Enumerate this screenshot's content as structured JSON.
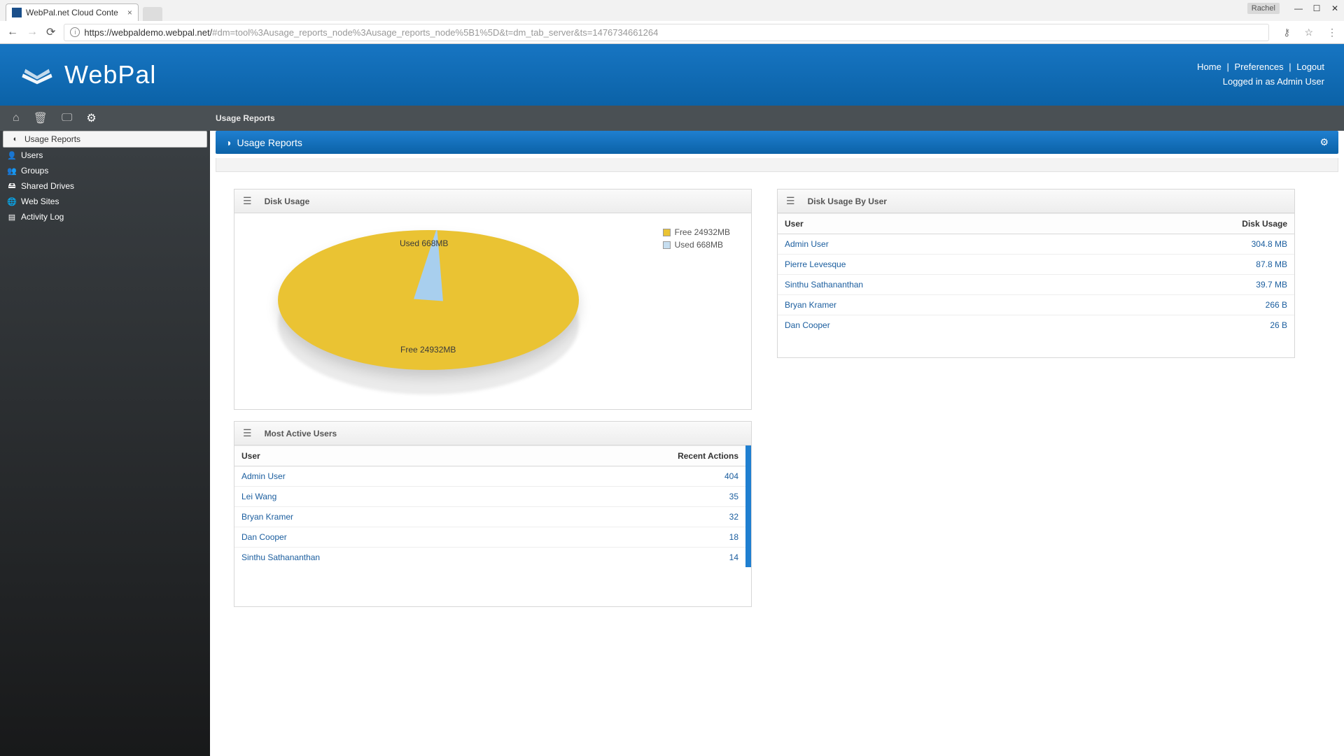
{
  "browser": {
    "tab_title": "WebPal.net Cloud Conte",
    "user_tag": "Rachel",
    "url_host": "https://webpaldemo.webpal.net/",
    "url_rest": "#dm=tool%3Ausage_reports_node%3Ausage_reports_node%5B1%5D&t=dm_tab_server&ts=1476734661264"
  },
  "header": {
    "links": {
      "home": "Home",
      "prefs": "Preferences",
      "logout": "Logout"
    },
    "logged_in": "Logged in as Admin User",
    "brand": "WebPal"
  },
  "breadcrumb": "Usage Reports",
  "page_title": "Usage Reports",
  "sidebar": {
    "items": [
      {
        "label": "Usage Reports"
      },
      {
        "label": "Users"
      },
      {
        "label": "Groups"
      },
      {
        "label": "Shared Drives"
      },
      {
        "label": "Web Sites"
      },
      {
        "label": "Activity Log"
      }
    ]
  },
  "disk_usage": {
    "title": "Disk Usage",
    "legend_free": "Free 24932MB",
    "legend_used": "Used 668MB",
    "label_free": "Free 24932MB",
    "label_used": "Used 668MB"
  },
  "chart_data": {
    "type": "pie",
    "title": "Disk Usage",
    "series": [
      {
        "name": "Free",
        "value": 24932,
        "unit": "MB",
        "color": "#eac333"
      },
      {
        "name": "Used",
        "value": 668,
        "unit": "MB",
        "color": "#a8cfee"
      }
    ]
  },
  "active_users": {
    "title": "Most Active Users",
    "col_user": "User",
    "col_actions": "Recent Actions",
    "rows": [
      {
        "user": "Admin User",
        "actions": "404"
      },
      {
        "user": "Lei Wang",
        "actions": "35"
      },
      {
        "user": "Bryan Kramer",
        "actions": "32"
      },
      {
        "user": "Dan Cooper",
        "actions": "18"
      },
      {
        "user": "Sinthu Sathananthan",
        "actions": "14"
      }
    ]
  },
  "disk_by_user": {
    "title": "Disk Usage By User",
    "col_user": "User",
    "col_usage": "Disk Usage",
    "rows": [
      {
        "user": "Admin User",
        "usage": "304.8 MB"
      },
      {
        "user": "Pierre Levesque",
        "usage": "87.8 MB"
      },
      {
        "user": "Sinthu Sathananthan",
        "usage": "39.7 MB"
      },
      {
        "user": "Bryan Kramer",
        "usage": "266 B"
      },
      {
        "user": "Dan Cooper",
        "usage": "26 B"
      }
    ]
  }
}
